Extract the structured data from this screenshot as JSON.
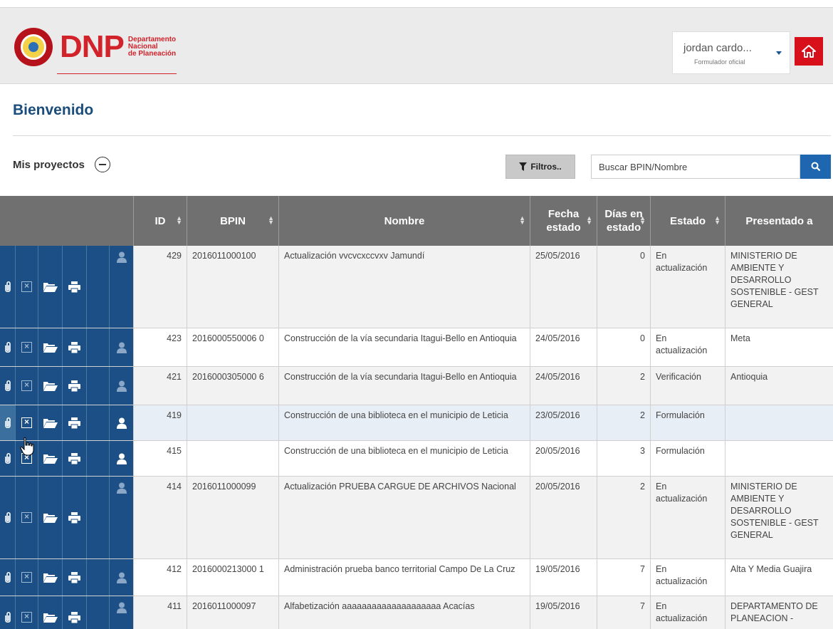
{
  "header": {
    "brand_word": "DNP",
    "brand_sub": [
      "Departamento",
      "Nacional",
      "de Planeación"
    ],
    "user_name": "jordan cardo...",
    "user_role": "Formulador oficial"
  },
  "page": {
    "title": "Bienvenido",
    "section_label": "Mis proyectos",
    "filter_label": "Filtros..",
    "search_placeholder": "Buscar BPIN/Nombre"
  },
  "table": {
    "columns": {
      "id": "ID",
      "bpin": "BPIN",
      "nombre": "Nombre",
      "fecha": "Fecha estado",
      "dias": "Días en estado",
      "estado": "Estado",
      "presentado": "Presentado a"
    },
    "rows": [
      {
        "id": "429",
        "bpin": "2016011000100",
        "nombre": "Actualización vvcvcxccvxv  Jamundí",
        "fecha": "25/05/2016",
        "dias": "0",
        "estado": "En actualización",
        "presentado": "MINISTERIO DE AMBIENTE Y DESARROLLO SOSTENIBLE - GEST GENERAL"
      },
      {
        "id": "423",
        "bpin": "2016000550006 0",
        "nombre": "Construcción  de la vía secundaria Itagui-Bello en Antioquia",
        "fecha": "24/05/2016",
        "dias": "0",
        "estado": "En actualización",
        "presentado": "Meta"
      },
      {
        "id": "421",
        "bpin": "2016000305000 6",
        "nombre": "Construcción de la vía secundaria Itagui-Bello en Antioquia",
        "fecha": "24/05/2016",
        "dias": "2",
        "estado": "Verificación",
        "presentado": "Antioquia"
      },
      {
        "id": "419",
        "bpin": "",
        "nombre": "Construcción de una biblioteca en el municipio de Leticia",
        "fecha": "23/05/2016",
        "dias": "2",
        "estado": "Formulación",
        "presentado": ""
      },
      {
        "id": "415",
        "bpin": "",
        "nombre": "Construcción de una biblioteca en el municipio de Leticia",
        "fecha": "20/05/2016",
        "dias": "3",
        "estado": "Formulación",
        "presentado": ""
      },
      {
        "id": "414",
        "bpin": "2016011000099",
        "nombre": "Actualización PRUEBA CARGUE DE ARCHIVOS Nacional",
        "fecha": "20/05/2016",
        "dias": "2",
        "estado": "En actualización",
        "presentado": "MINISTERIO DE AMBIENTE Y DESARROLLO SOSTENIBLE - GEST GENERAL"
      },
      {
        "id": "412",
        "bpin": "2016000213000 1",
        "nombre": "Administración prueba banco territorial   Campo De La Cruz",
        "fecha": "19/05/2016",
        "dias": "7",
        "estado": "En actualización",
        "presentado": "Alta Y Media Guajira"
      },
      {
        "id": "411",
        "bpin": "2016011000097",
        "nombre": "Alfabetización aaaaaaaaaaaaaaaaaaaa  Acacías",
        "fecha": "19/05/2016",
        "dias": "7",
        "estado": "En actualización",
        "presentado": "DEPARTAMENTO DE PLANEACION -"
      }
    ]
  },
  "icons": {
    "attach": "paperclip-icon",
    "delete": "close-box-icon",
    "open": "folder-open-icon",
    "print": "print-icon",
    "assign": "user-icon",
    "home": "home-icon",
    "search": "search-icon",
    "filter": "filter-icon"
  },
  "colors": {
    "brand_red": "#d2232a",
    "action_blue": "#1b4f85",
    "header_gray": "#707070",
    "title_blue": "#1a4d7c"
  }
}
